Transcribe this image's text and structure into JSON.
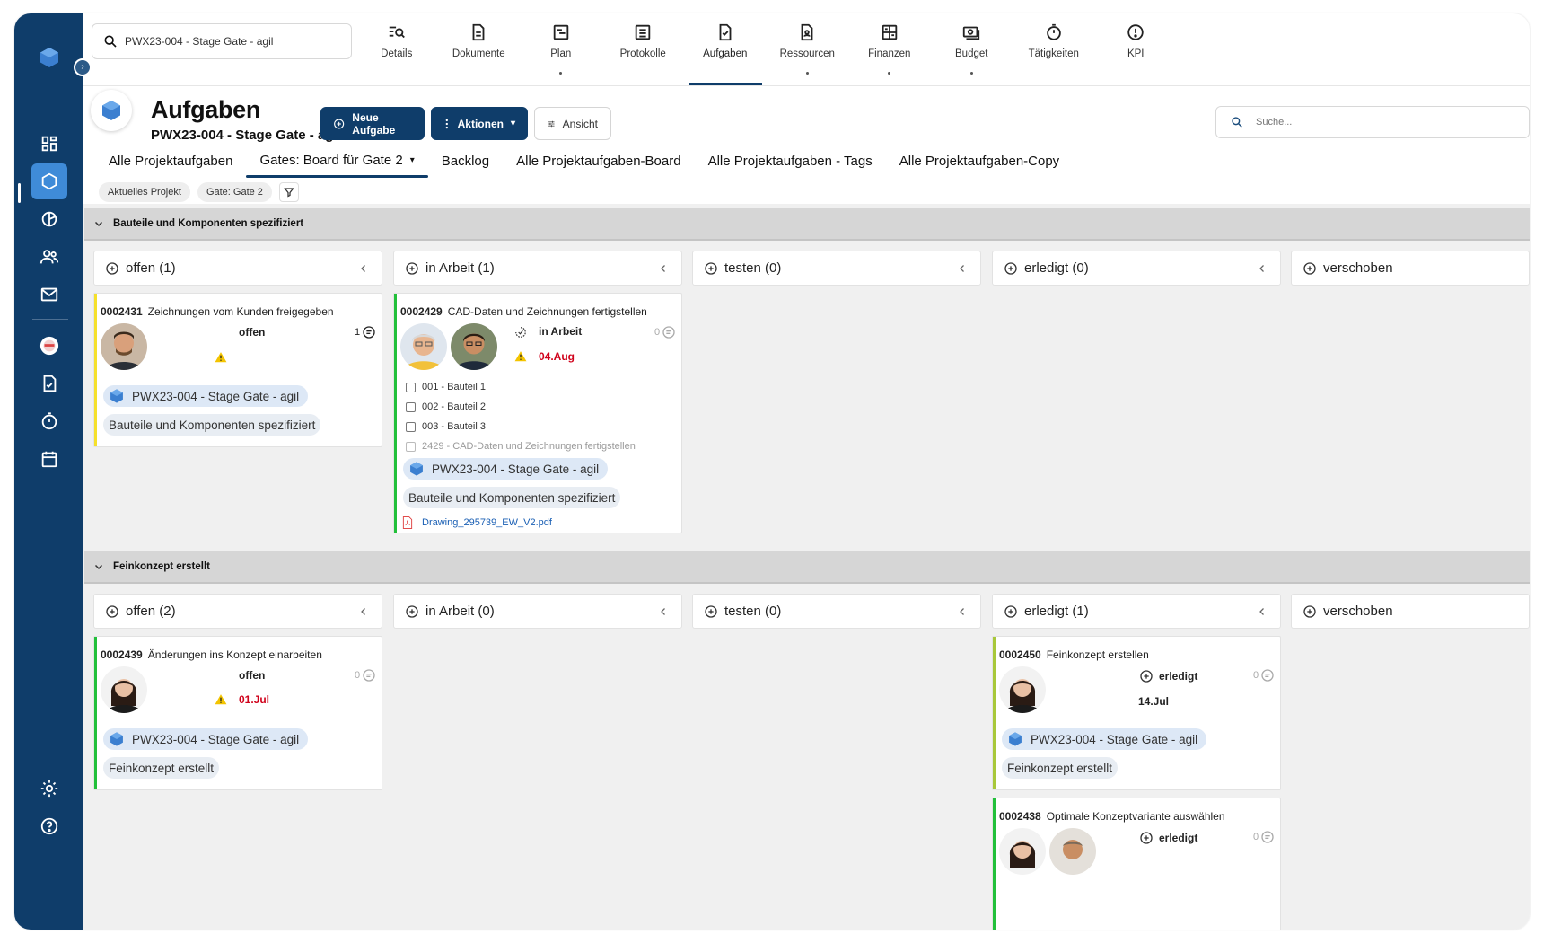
{
  "top_search": {
    "value": "PWX23-004 - Stage Gate - agil"
  },
  "top_nav": [
    {
      "label": "Details",
      "icon": "search-list-icon",
      "dot": false
    },
    {
      "label": "Dokumente",
      "icon": "document-icon",
      "dot": false
    },
    {
      "label": "Plan",
      "icon": "plan-icon",
      "dot": true
    },
    {
      "label": "Protokolle",
      "icon": "list-icon",
      "dot": false
    },
    {
      "label": "Aufgaben",
      "icon": "task-check-icon",
      "dot": false,
      "active": true
    },
    {
      "label": "Ressourcen",
      "icon": "resource-doc-icon",
      "dot": true
    },
    {
      "label": "Finanzen",
      "icon": "calculator-icon",
      "dot": true
    },
    {
      "label": "Budget",
      "icon": "money-icon",
      "dot": true
    },
    {
      "label": "Tätigkeiten",
      "icon": "stopwatch-icon",
      "dot": false
    },
    {
      "label": "KPI",
      "icon": "alert-circle-icon",
      "dot": false
    }
  ],
  "header": {
    "title": "Aufgaben",
    "subtitle": "PWX23-004 - Stage Gate - agil",
    "new_task_label": "Neue Aufgabe",
    "actions_label": "Aktionen",
    "view_label": "Ansicht",
    "search_placeholder": "Suche..."
  },
  "tabs": [
    {
      "label": "Alle Projektaufgaben"
    },
    {
      "label": "Gates: Board für Gate 2",
      "active": true
    },
    {
      "label": "Backlog"
    },
    {
      "label": "Alle Projektaufgaben-Board"
    },
    {
      "label": "Alle Projektaufgaben - Tags"
    },
    {
      "label": "Alle Projektaufgaben-Copy"
    }
  ],
  "chips": [
    "Aktuelles Projekt",
    "Gate: Gate 2"
  ],
  "groups": [
    {
      "title": "Bauteile und Komponenten spezifiziert",
      "columns": [
        "offen (1)",
        "in Arbeit (1)",
        "testen (0)",
        "erledigt (0)",
        "verschoben"
      ],
      "cards": [
        {
          "id": "0002431",
          "title": "Zeichnungen vom Kunden freigegeben",
          "status": "offen",
          "comments": "1",
          "project": "PWX23-004 - Stage Gate - agil",
          "group_tag": "Bauteile und Komponenten spezifiziert",
          "bar_color": "#f5e02a"
        },
        {
          "id": "0002429",
          "title": "CAD-Daten und Zeichnungen fertigstellen",
          "status": "in Arbeit",
          "comments": "0",
          "due": "04.Aug",
          "checklist": [
            "001 - Bauteil 1",
            "002 - Bauteil 2",
            "003 - Bauteil 3",
            "2429 - CAD-Daten und Zeichnungen fertigstellen"
          ],
          "project": "PWX23-004 - Stage Gate - agil",
          "group_tag": "Bauteile und Komponenten spezifiziert",
          "attachment": "Drawing_295739_EW_V2.pdf",
          "bar_color": "#22c03a"
        }
      ]
    },
    {
      "title": "Feinkonzept erstellt",
      "columns": [
        "offen (2)",
        "in Arbeit (0)",
        "testen (0)",
        "erledigt (1)",
        "verschoben"
      ],
      "cards": [
        {
          "id": "0002439",
          "title": "Änderungen ins Konzept einarbeiten",
          "status": "offen",
          "comments": "0",
          "due": "01.Jul",
          "project": "PWX23-004 - Stage Gate - agil",
          "group_tag": "Feinkonzept erstellt",
          "bar_color": "#22c03a"
        },
        {
          "id": "0002450",
          "title": "Feinkonzept erstellen",
          "status": "erledigt",
          "comments": "0",
          "done_date": "14.Jul",
          "project": "PWX23-004 - Stage Gate - agil",
          "group_tag": "Feinkonzept erstellt",
          "bar_color": "#a8c83a"
        },
        {
          "id": "0002438",
          "title": "Optimale Konzeptvariante auswählen",
          "status": "erledigt",
          "comments": "0",
          "bar_color": "#22c03a"
        }
      ]
    }
  ]
}
